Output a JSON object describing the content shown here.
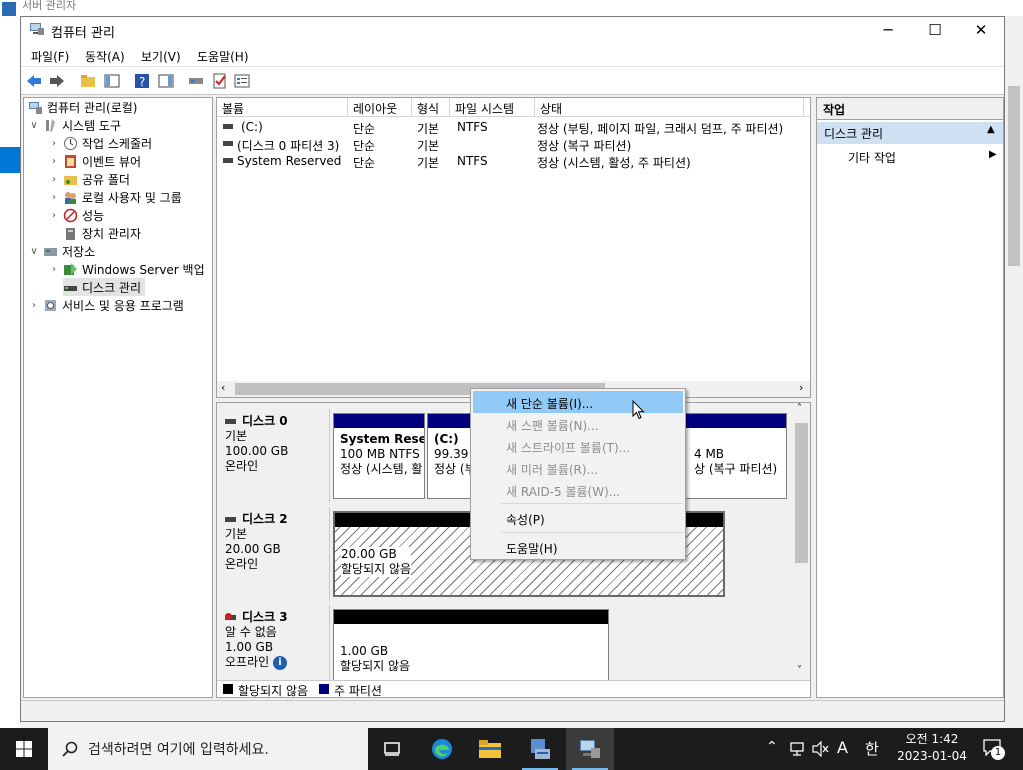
{
  "background": {
    "title": "서버 관리자"
  },
  "window": {
    "title": "컴퓨터 관리",
    "min": "─",
    "max": "☐",
    "close": "✕"
  },
  "menu": [
    "파일(F)",
    "동작(A)",
    "보기(V)",
    "도움말(H)"
  ],
  "tree": {
    "root": "컴퓨터 관리(로컬)",
    "system_tools": "시스템 도구",
    "task_scheduler": "작업 스케줄러",
    "event_viewer": "이벤트 뷰어",
    "shared_folders": "공유 폴더",
    "local_users": "로컬 사용자 및 그룹",
    "performance": "성능",
    "device_manager": "장치 관리자",
    "storage": "저장소",
    "backup": "Windows Server 백업",
    "disk_management": "디스크 관리",
    "services": "서비스 및 응용 프로그램"
  },
  "volumes": {
    "headers": [
      "볼륨",
      "레이아웃",
      "형식",
      "파일 시스템",
      "상태"
    ],
    "rows": [
      {
        "name": "(C:)",
        "layout": "단순",
        "type": "기본",
        "fs": "NTFS",
        "status": "정상 (부팅, 페이지 파일, 크래시 덤프, 주 파티션)"
      },
      {
        "name": "(디스크 0 파티션 3)",
        "layout": "단순",
        "type": "기본",
        "fs": "",
        "status": "정상 (복구 파티션)"
      },
      {
        "name": "System Reserved",
        "layout": "단순",
        "type": "기본",
        "fs": "NTFS",
        "status": "정상 (시스템, 활성, 주 파티션)"
      }
    ]
  },
  "disks": {
    "disk0": {
      "name": "디스크 0",
      "type": "기본",
      "size": "100.00 GB",
      "state": "온라인",
      "p1": {
        "name": "System Reser",
        "size": "100 MB NTFS",
        "status": "정상 (시스템, 활"
      },
      "p2": {
        "name": "(C:)",
        "size": "99.39 G",
        "status": "정상 (부"
      },
      "p3": {
        "size": "4 MB",
        "status": "상 (복구 파티션)"
      }
    },
    "disk2": {
      "name": "디스크 2",
      "type": "기본",
      "size": "20.00 GB",
      "state": "온라인",
      "p1": {
        "size": "20.00 GB",
        "status": "할당되지 않음"
      }
    },
    "disk3": {
      "name": "디스크 3",
      "type": "알 수 없음",
      "size": "1.00 GB",
      "state": "오프라인",
      "p1": {
        "size": "1.00 GB",
        "status": "할당되지 않음"
      }
    }
  },
  "legend": {
    "unallocated": "할당되지 않음",
    "primary": "주 파티션"
  },
  "actions": {
    "header": "작업",
    "section": "디스크 관리",
    "more": "기타 작업"
  },
  "context_menu": {
    "new_simple": "새 단순 볼륨(I)...",
    "new_spanned": "새 스팬 볼륨(N)...",
    "new_striped": "새 스트라이프 볼륨(T)...",
    "new_mirror": "새 미러 볼륨(R)...",
    "new_raid5": "새 RAID-5 볼륨(W)...",
    "properties": "속성(P)",
    "help": "도움말(H)"
  },
  "taskbar": {
    "search_placeholder": "검색하려면 여기에 입력하세요.",
    "ime": "A",
    "lang": "한",
    "time": "오전 1:42",
    "date": "2023-01-04",
    "notifications": "1"
  },
  "colors": {
    "primary_partition": "#00007f",
    "unallocated": "#000000",
    "highlight": "#91c9f7"
  }
}
